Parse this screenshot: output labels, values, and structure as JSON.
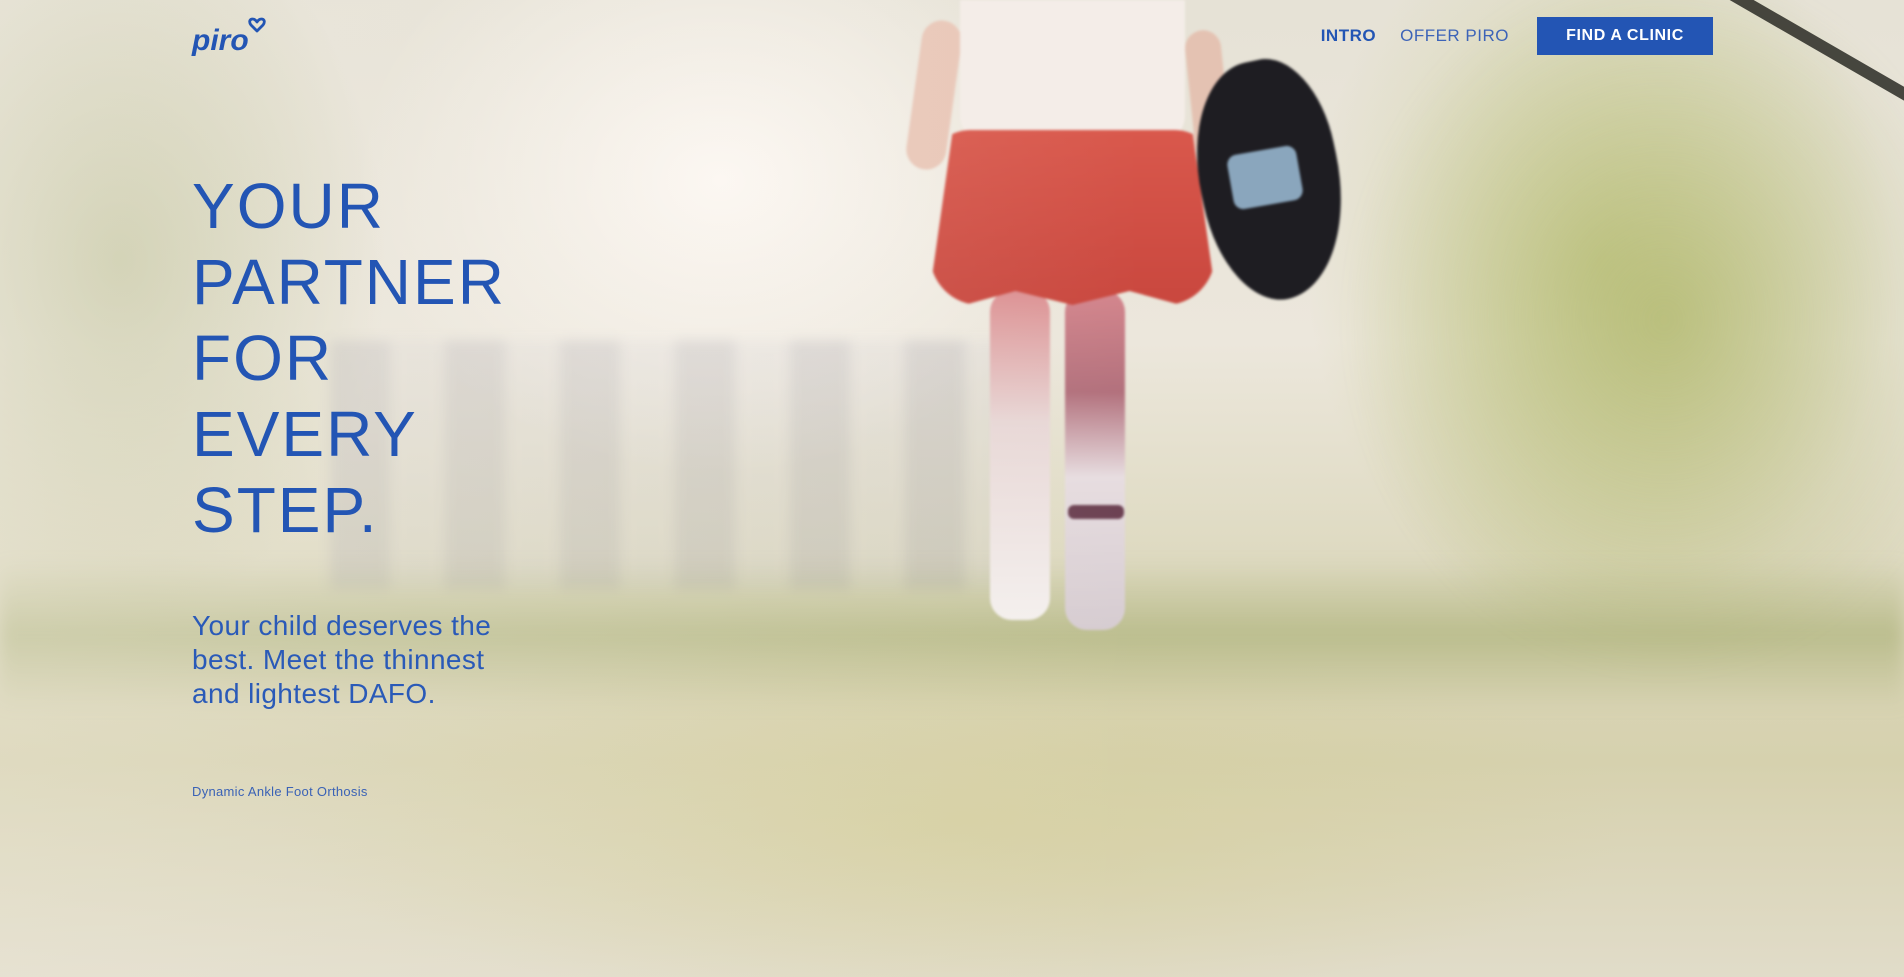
{
  "brand": {
    "name": "piro",
    "color": "#2355b4"
  },
  "nav": {
    "items": [
      {
        "label": "INTRO",
        "active": true
      },
      {
        "label": "OFFER PIRO",
        "active": false
      }
    ],
    "cta_label": "FIND A CLINIC"
  },
  "hero": {
    "headline_lines": [
      "YOUR",
      "PARTNER",
      "FOR",
      "EVERY",
      "STEP."
    ],
    "subheadline": "Your child deserves the best. Meet the thinnest and lightest DAFO.",
    "caption": "Dynamic Ankle Foot Orthosis"
  },
  "background": {
    "description_icon": "hero-photo-child-walking-with-dafo"
  }
}
